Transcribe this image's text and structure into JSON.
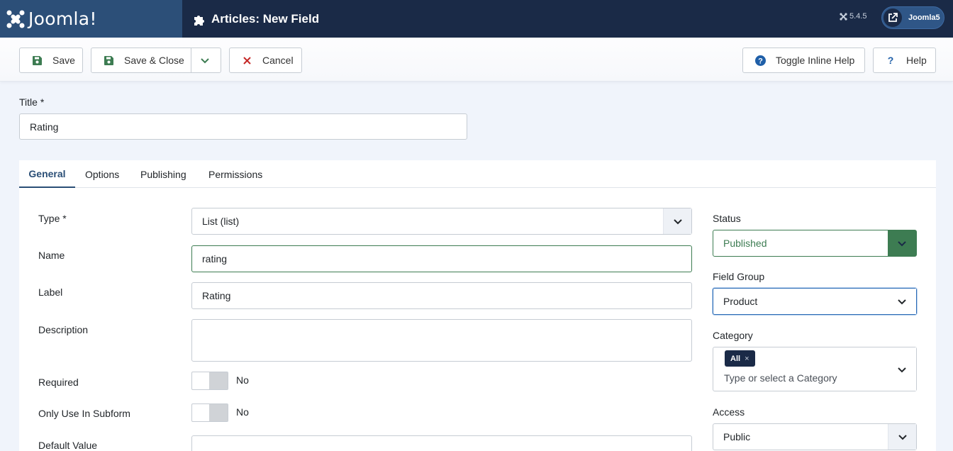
{
  "header": {
    "logo_text": "Joomla!",
    "page_title": "Articles: New Field",
    "version": "5.4.5",
    "user_label": "Joomla5"
  },
  "toolbar": {
    "save_label": "Save",
    "save_close_label": "Save & Close",
    "cancel_label": "Cancel",
    "toggle_help_label": "Toggle Inline Help",
    "help_label": "Help"
  },
  "title_field": {
    "label": "Title *",
    "value": "Rating"
  },
  "tabs": [
    {
      "label": "General",
      "active": true
    },
    {
      "label": "Options",
      "active": false
    },
    {
      "label": "Publishing",
      "active": false
    },
    {
      "label": "Permissions",
      "active": false
    }
  ],
  "general": {
    "type_label": "Type *",
    "type_value": "List (list)",
    "name_label": "Name",
    "name_value": "rating",
    "label_label": "Label",
    "label_value": "Rating",
    "description_label": "Description",
    "description_value": "",
    "required_label": "Required",
    "required_value": "No",
    "subform_label": "Only Use In Subform",
    "subform_value": "No",
    "default_label": "Default Value"
  },
  "side": {
    "status_label": "Status",
    "status_value": "Published",
    "group_label": "Field Group",
    "group_value": "Product",
    "category_label": "Category",
    "category_tag": "All",
    "category_tag_remove": "×",
    "category_placeholder": "Type or select a Category",
    "access_label": "Access",
    "access_value": "Public"
  },
  "colors": {
    "header_bg": "#1a2a47",
    "logo_bg": "#2c4f78",
    "status_green": "#3d7c52",
    "accent_blue": "#2a4e76"
  }
}
